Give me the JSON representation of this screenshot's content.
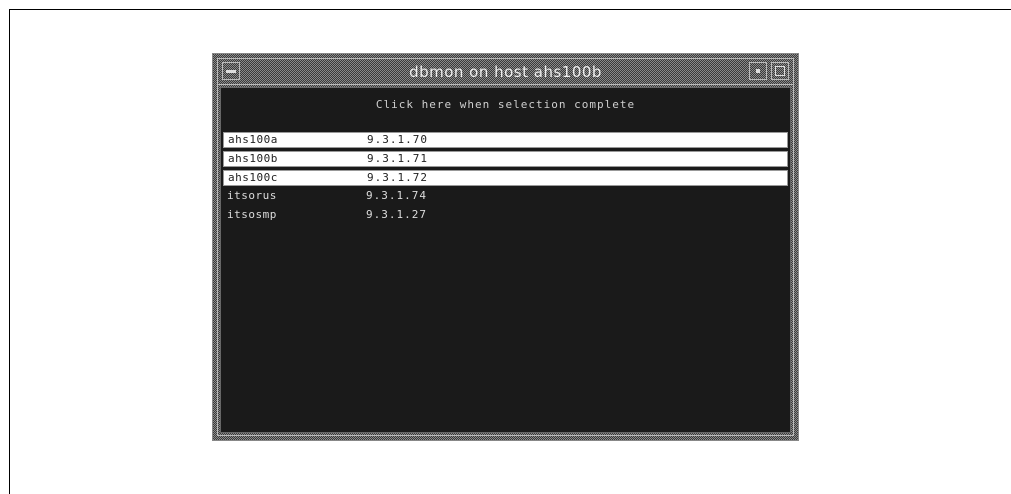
{
  "window": {
    "title": "dbmon on host ahs100b"
  },
  "prompt": "Click here when selection complete",
  "hosts": [
    {
      "name": "ahs100a",
      "ip": "9.3.1.70",
      "selected": true
    },
    {
      "name": "ahs100b",
      "ip": "9.3.1.71",
      "selected": true
    },
    {
      "name": "ahs100c",
      "ip": "9.3.1.72",
      "selected": true
    },
    {
      "name": "itsorus",
      "ip": "9.3.1.74",
      "selected": false
    },
    {
      "name": "itsosmp",
      "ip": "9.3.1.27",
      "selected": false
    }
  ],
  "colors": {
    "background": "#ffffff",
    "client_area": "#1a1a1a",
    "selection": "#ffffff",
    "text_light": "#dcdcdc"
  },
  "icons": {
    "window_menu": "window-menu-icon",
    "minimize": "minimize-icon",
    "maximize": "maximize-icon"
  }
}
